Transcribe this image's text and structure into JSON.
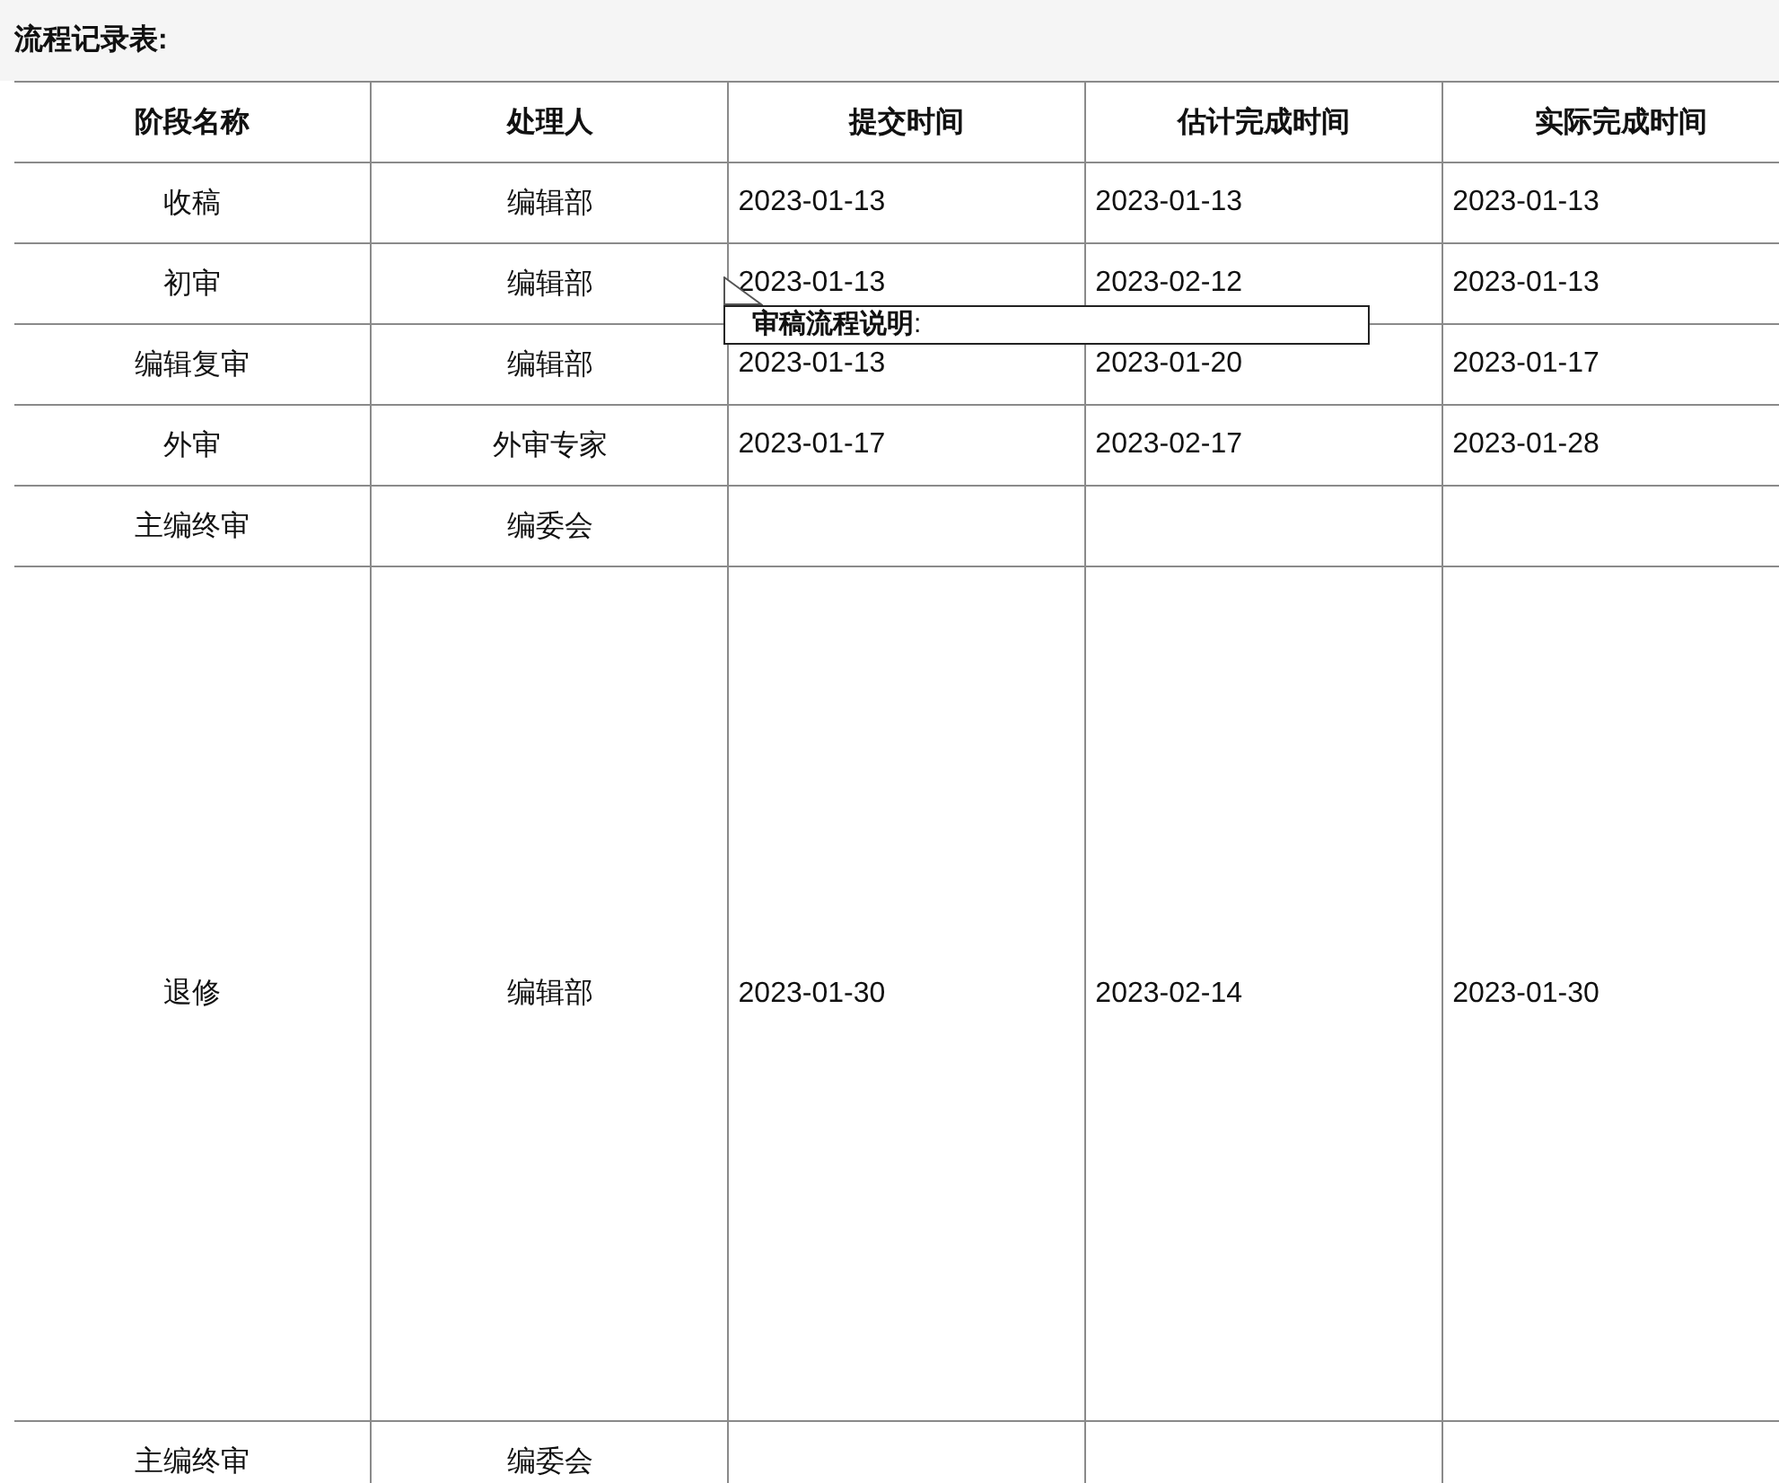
{
  "title": "流程记录表:",
  "table": {
    "columns": [
      "阶段名称",
      "处理人",
      "提交时间",
      "估计完成时间",
      "实际完成时间"
    ],
    "rows": [
      {
        "stage": "收稿",
        "handler": "编辑部",
        "submitted": "2023-01-13",
        "estimated": "2023-01-13",
        "actual": "2023-01-13"
      },
      {
        "stage": "初审",
        "handler": "编辑部",
        "submitted": "2023-01-13",
        "estimated": "2023-02-12",
        "actual": "2023-01-13"
      },
      {
        "stage": "编辑复审",
        "handler": "编辑部",
        "submitted": "2023-01-13",
        "estimated": "2023-01-20",
        "actual": "2023-01-17"
      },
      {
        "stage": "外审",
        "handler": "外审专家",
        "submitted": "2023-01-17",
        "estimated": "2023-02-17",
        "actual": "2023-01-28"
      },
      {
        "stage": "主编终审",
        "handler": "编委会"
      },
      {
        "stage": "退修",
        "handler": "编辑部",
        "submitted": "2023-01-30",
        "estimated": "2023-02-14",
        "actual": "2023-01-30"
      },
      {
        "stage": "主编终审",
        "handler": "编委会"
      }
    ]
  },
  "tooltip": {
    "text": "**审稿流程说明**:"
  }
}
